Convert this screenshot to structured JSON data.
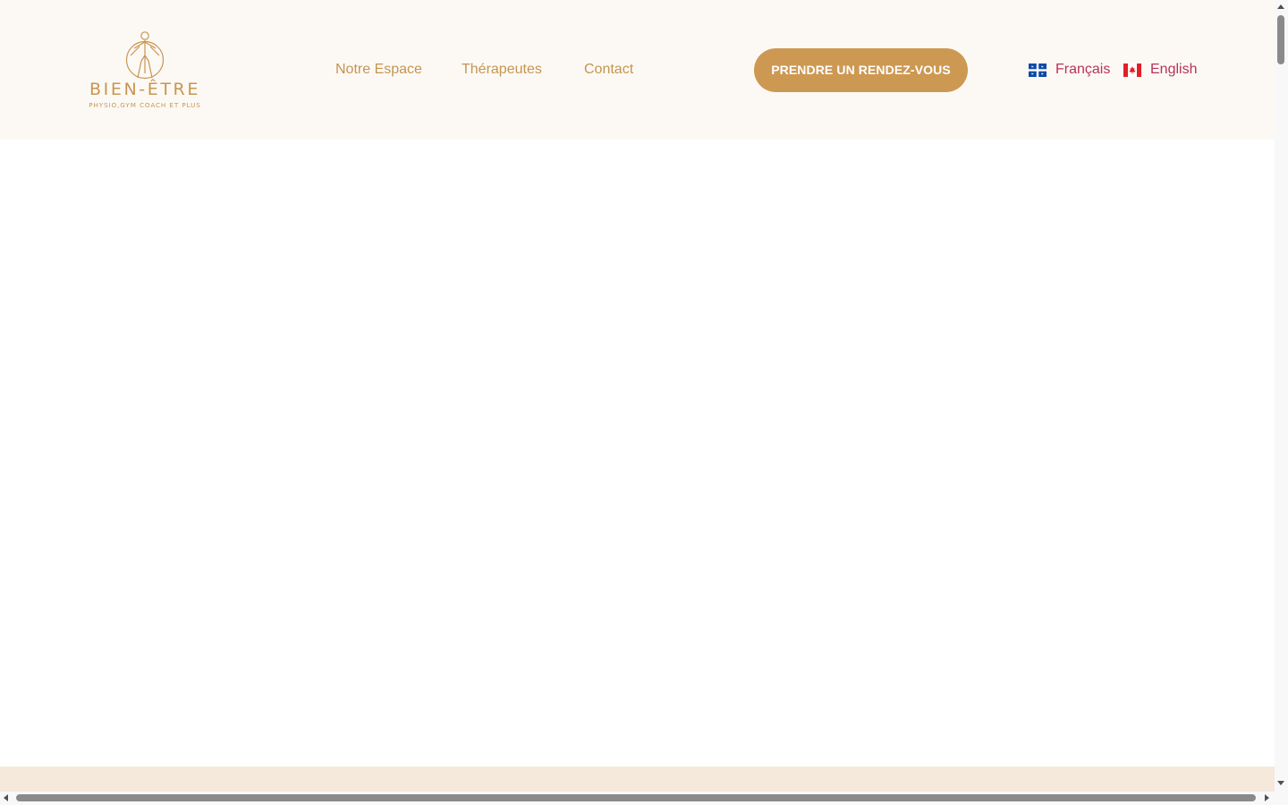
{
  "header": {
    "logo": {
      "wordmark": "BIEN-ÊTRE",
      "tagline": "PHYSIO,GYM COACH ET PLUS",
      "icon": "vitruvian-figure-icon"
    },
    "nav": [
      {
        "label": "Notre Espace"
      },
      {
        "label": "Thérapeutes"
      },
      {
        "label": "Contact"
      }
    ],
    "cta_label": "PRENDRE UN RENDEZ-VOUS",
    "languages": [
      {
        "label": "Français",
        "icon": "quebec-flag-icon"
      },
      {
        "label": "English",
        "icon": "canada-flag-icon"
      }
    ]
  },
  "colors": {
    "header_bg": "#fcf9f5",
    "brand_gold": "#c99550",
    "cta_bg": "#cd9852",
    "language_link": "#b8325a",
    "footer_band": "#f5e9dc"
  }
}
